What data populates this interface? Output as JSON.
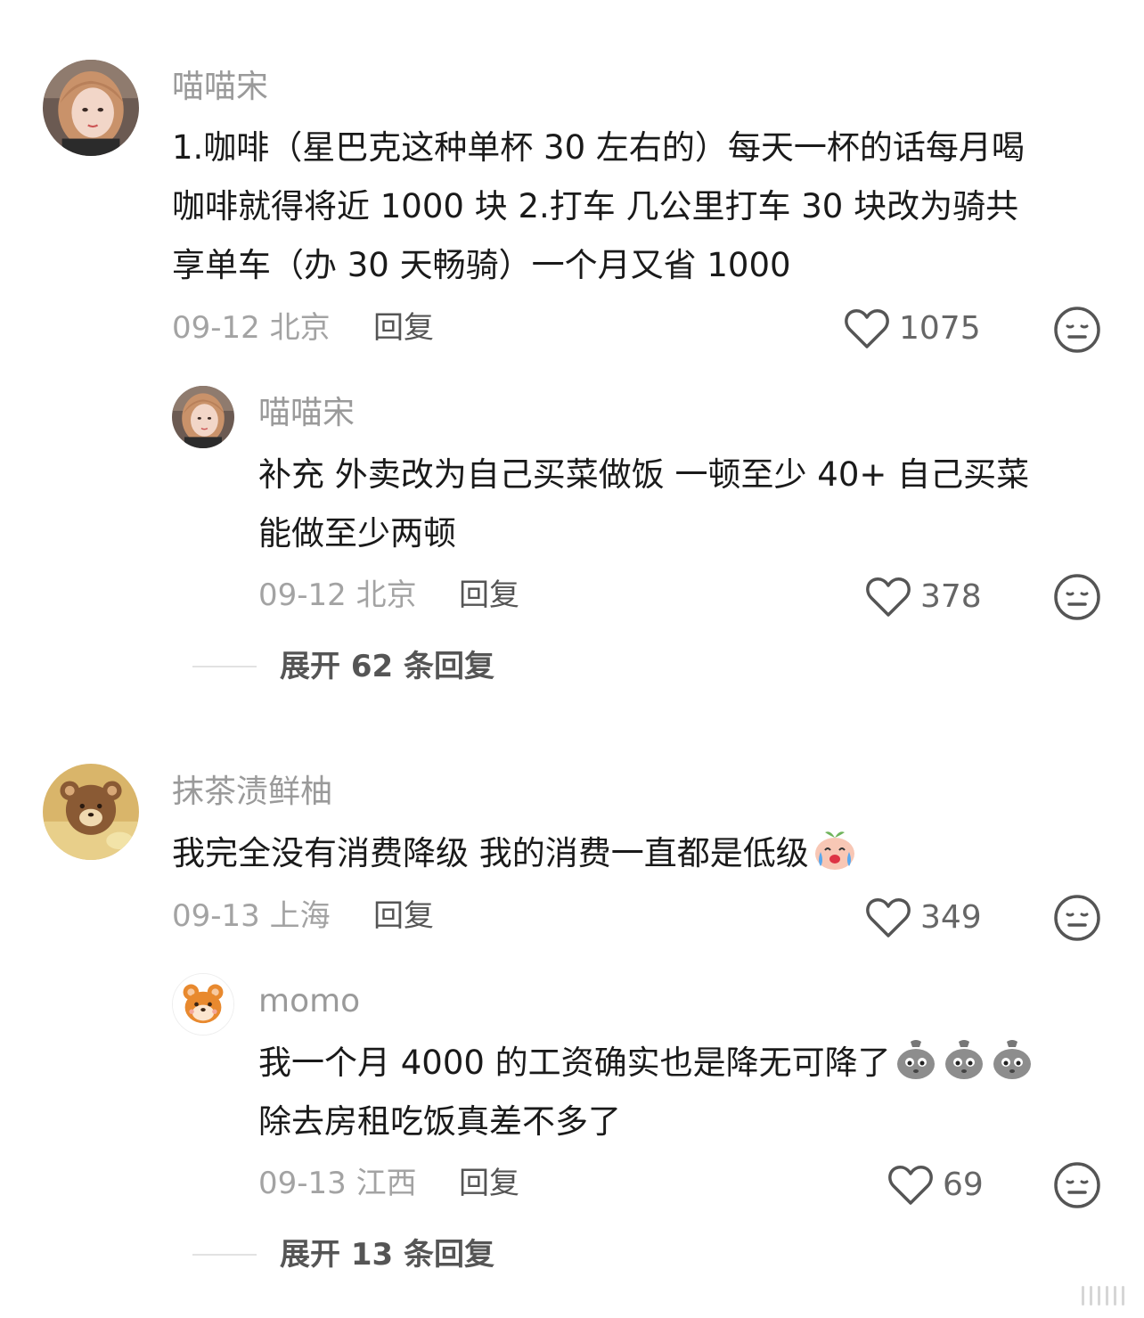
{
  "comments": [
    {
      "username": "喵喵宋",
      "text_lines": [
        "1.咖啡（星巴克这种单杯 30 左右的）每天一杯的话每月喝",
        "咖啡就得将近 1000 块 2.打车 几公里打车 30 块改为骑共",
        "享单车（办 30 天畅骑）一个月又省 1000"
      ],
      "date": "09-12",
      "location": "北京",
      "reply_label": "回复",
      "likes": "1075",
      "replies": [
        {
          "username": "喵喵宋",
          "text_lines": [
            "补充 外卖改为自己买菜做饭 一顿至少 40+ 自己买菜",
            "能做至少两顿"
          ],
          "date": "09-12",
          "location": "北京",
          "reply_label": "回复",
          "likes": "378"
        }
      ],
      "expand_label": "展开 62 条回复"
    },
    {
      "username": "抹茶渍鲜柚",
      "text_lines": [
        "我完全没有消费降级 我的消费一直都是低级"
      ],
      "date": "09-13",
      "location": "上海",
      "reply_label": "回复",
      "likes": "349",
      "replies": [
        {
          "username": "momo",
          "text_lines": [
            "我一个月 4000 的工资确实也是降无可降了",
            "除去房租吃饭真差不多了"
          ],
          "date": "09-13",
          "location": "江西",
          "reply_label": "回复",
          "likes": "69"
        }
      ],
      "expand_label": "展开 13 条回复"
    }
  ],
  "colors": {
    "username": "#9a9a9a",
    "text": "#1a1a1a",
    "meta": "#a3a3a3",
    "action": "#555555"
  },
  "icons": {
    "like": "heart-outline-icon",
    "dislike": "neutral-face-icon",
    "crying_emoji": "crying-peach-emoji-icon",
    "sack_emoji": "sweating-sack-emoji-icon"
  }
}
